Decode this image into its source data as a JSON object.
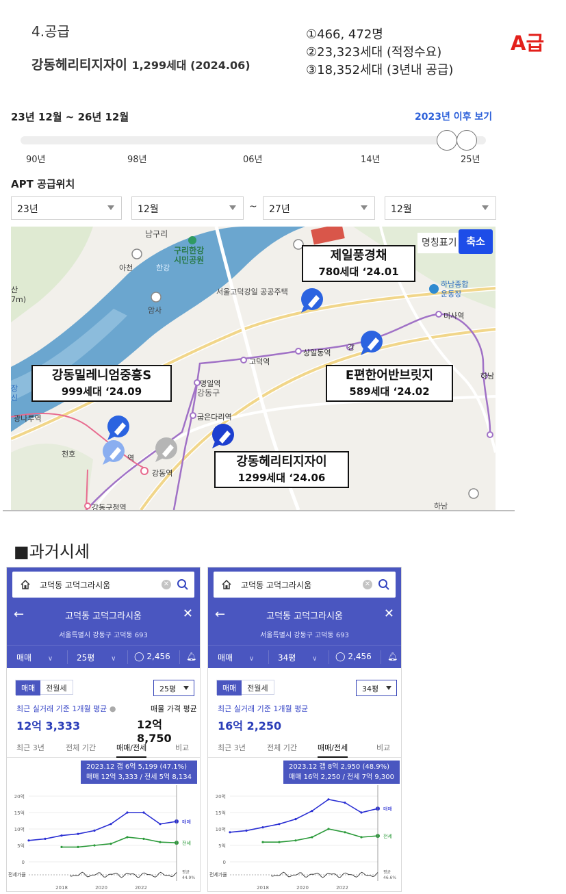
{
  "header": {
    "section": "4.공급",
    "complex": "강동헤리티지자이",
    "complex_detail": "1,299세대 (2024.06)",
    "stats": [
      "①466, 472명",
      "②23,323세대 (적정수요)",
      "③18,352세대 (3년내 공급)"
    ],
    "grade": "A급"
  },
  "supply": {
    "period_label": "23년 12월 ~ 26년 12월",
    "since_link": "2023년 이후 보기",
    "ticks": [
      "90년",
      "98년",
      "06년",
      "14년",
      "25년"
    ],
    "apt_label": "APT 공급위치",
    "selects": [
      "23년",
      "12월",
      "27년",
      "12월"
    ],
    "tilde": "~"
  },
  "map": {
    "btn_names": "명칭표기",
    "btn_shrink": "축소",
    "callouts": [
      {
        "line1": "제일풍경채",
        "line2": "780세대 ‘24.01"
      },
      {
        "line1": "강동밀레니엄중흥S",
        "line2": "999세대 ‘24.09"
      },
      {
        "line1": "E편한어반브릿지",
        "line2": "589세대 ‘24.02"
      },
      {
        "line1": "강동헤리티지자이",
        "line2": "1299세대 ‘24.06"
      }
    ],
    "labels": {
      "namguri": "남구리",
      "guri_park": "구리한강",
      "guri_park2": "시민공원",
      "icheon": "아천",
      "hangang": "한강",
      "amsa": "암사",
      "gangil": "서울고덕강일 공공주택",
      "godeok": "고덕역",
      "sangil": "상일동역",
      "misa": "미사역",
      "hanam_sports": "하남종합",
      "hanam_sports2": "운동장",
      "myeongil": "명일역",
      "gangdong_gu": "강동구",
      "gubeundari": "굽은다리역",
      "cheonho": "천호",
      "gangdong_st": "강동역",
      "gu_office": "강동구청역",
      "gwangnaru": "광나루역",
      "san": "산",
      "seven_m": "7m)",
      "hana": "하남",
      "hana2": "하남",
      "jang": "장",
      "sin": "신",
      "yeok": "역",
      "gang": "강"
    }
  },
  "past": {
    "title": "■과거시세",
    "cards": [
      {
        "search": "고덕동 고덕그라시움",
        "title": "고덕동 고덕그라시움",
        "address": "서울특별시 강동구 고덕동 693",
        "trade": "매매",
        "size": "25평",
        "comments": "2,456",
        "toggle_on": "매매",
        "toggle_off": "전월세",
        "size_select": "25평",
        "avg_label": "최근 실거래 기준 1개월 평균",
        "avg_value": "12억 3,333",
        "ask_label": "매물 가격 평균",
        "ask_value": "12억 8,750",
        "tabs": [
          "최근 3년",
          "전체 기간",
          "매매/전세",
          "비교"
        ],
        "tip_line1": "2023.12  갭 6억 5,199 (47.1%)",
        "tip_line2": "매매 12억 3,333 / 전세 5억 8,134",
        "y_ticks": [
          "20억",
          "15억",
          "10억",
          "5억",
          "0"
        ],
        "x_ticks": [
          "2018",
          "2020",
          "2022"
        ],
        "series_labels": {
          "sale": "매매",
          "jeonse": "전세"
        },
        "ratio_label": "전세가율",
        "ratio_avg": "평균",
        "ratio_value": "44.9%"
      },
      {
        "search": "고덕동 고덕그라시움",
        "title": "고덕동 고덕그라시움",
        "address": "서울특별시 강동구 고덕동 693",
        "trade": "매매",
        "size": "34평",
        "comments": "2,456",
        "toggle_on": "매매",
        "toggle_off": "전월세",
        "size_select": "34평",
        "avg_label": "최근 실거래 기준 1개월 평균",
        "avg_value": "16억 2,250",
        "ask_label": "",
        "ask_value": "",
        "tabs": [
          "최근 3년",
          "전체 기간",
          "매매/전세",
          "비교"
        ],
        "tip_line1": "2023.12  갭 8억 2,950 (48.9%)",
        "tip_line2": "매매 16억 2,250 / 전세 7억 9,300",
        "y_ticks": [
          "20억",
          "15억",
          "10억",
          "5억",
          "0"
        ],
        "x_ticks": [
          "2018",
          "2020",
          "2022"
        ],
        "series_labels": {
          "sale": "매매",
          "jeonse": "전세"
        },
        "ratio_label": "전세가율",
        "ratio_avg": "평균",
        "ratio_value": "46.6%"
      }
    ]
  },
  "chart_data": [
    {
      "type": "line",
      "x": [
        "2015",
        "2016",
        "2017",
        "2018",
        "2019",
        "2020",
        "2021",
        "2022",
        "2023",
        "2023.12"
      ],
      "series": [
        {
          "name": "매매",
          "values": [
            6.5,
            7,
            8,
            8.5,
            9.5,
            11.5,
            15,
            15,
            11.5,
            12.3
          ]
        },
        {
          "name": "전세",
          "values": [
            null,
            null,
            4.5,
            4.5,
            5.0,
            5.5,
            7.5,
            7,
            6,
            5.8
          ]
        }
      ],
      "ylim": [
        0,
        20
      ]
    },
    {
      "type": "line",
      "x": [
        "2015",
        "2016",
        "2017",
        "2018",
        "2019",
        "2020",
        "2021",
        "2022",
        "2023",
        "2023.12"
      ],
      "series": [
        {
          "name": "매매",
          "values": [
            9,
            9.5,
            10.5,
            11.5,
            13,
            15.5,
            19,
            18,
            15,
            16.2
          ]
        },
        {
          "name": "전세",
          "values": [
            null,
            null,
            6,
            6,
            6.5,
            7.5,
            10,
            9,
            7.5,
            7.9
          ]
        }
      ],
      "ylim": [
        0,
        20
      ]
    }
  ]
}
